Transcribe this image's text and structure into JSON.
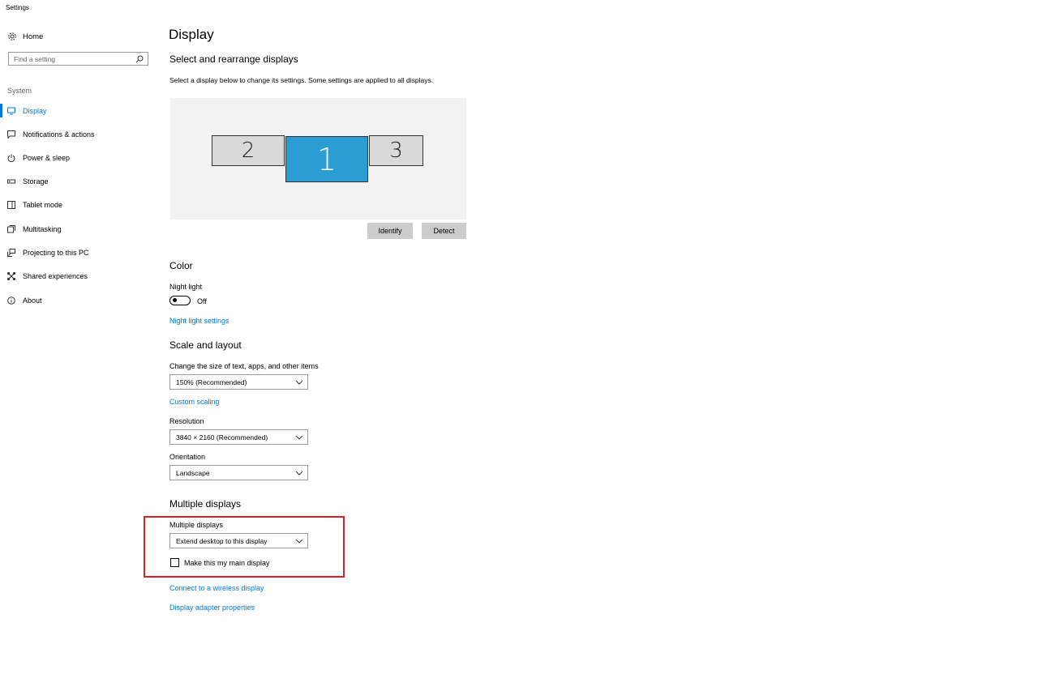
{
  "window": {
    "title": "Settings"
  },
  "sidebar": {
    "home_label": "Home",
    "search_placeholder": "Find a setting",
    "section_label": "System",
    "items": [
      {
        "label": "Display",
        "icon": "monitor-icon",
        "active": true
      },
      {
        "label": "Notifications & actions",
        "icon": "notification-icon"
      },
      {
        "label": "Power & sleep",
        "icon": "power-icon"
      },
      {
        "label": "Storage",
        "icon": "storage-icon"
      },
      {
        "label": "Tablet mode",
        "icon": "tablet-icon"
      },
      {
        "label": "Multitasking",
        "icon": "multitasking-icon"
      },
      {
        "label": "Projecting to this PC",
        "icon": "projecting-icon"
      },
      {
        "label": "Shared experiences",
        "icon": "shared-experiences-icon"
      },
      {
        "label": "About",
        "icon": "info-icon"
      }
    ]
  },
  "main": {
    "title": "Display",
    "arrange": {
      "heading": "Select and rearrange displays",
      "description": "Select a display below to change its settings. Some settings are applied to all displays.",
      "monitors": [
        {
          "label": "2",
          "selected": false
        },
        {
          "label": "1",
          "selected": true
        },
        {
          "label": "3",
          "selected": false
        }
      ],
      "identify_label": "Identify",
      "detect_label": "Detect"
    },
    "color": {
      "heading": "Color",
      "night_light_label": "Night light",
      "night_light_state": "Off",
      "night_light_settings_link": "Night light settings"
    },
    "scale": {
      "heading": "Scale and layout",
      "size_label": "Change the size of text, apps, and other items",
      "size_value": "150% (Recommended)",
      "custom_scaling_link": "Custom scaling",
      "resolution_label": "Resolution",
      "resolution_value": "3840 × 2160 (Recommended)",
      "orientation_label": "Orientation",
      "orientation_value": "Landscape"
    },
    "multiple": {
      "heading": "Multiple displays",
      "label": "Multiple displays",
      "value": "Extend desktop to this display",
      "main_display_label": "Make this my main display",
      "main_display_checked": false,
      "wireless_link": "Connect to a wireless display",
      "adapter_link": "Display adapter properties"
    }
  },
  "colors": {
    "accent": "#0078d7",
    "selected_monitor": "#2b9dd3",
    "highlight_border": "#e02020"
  }
}
